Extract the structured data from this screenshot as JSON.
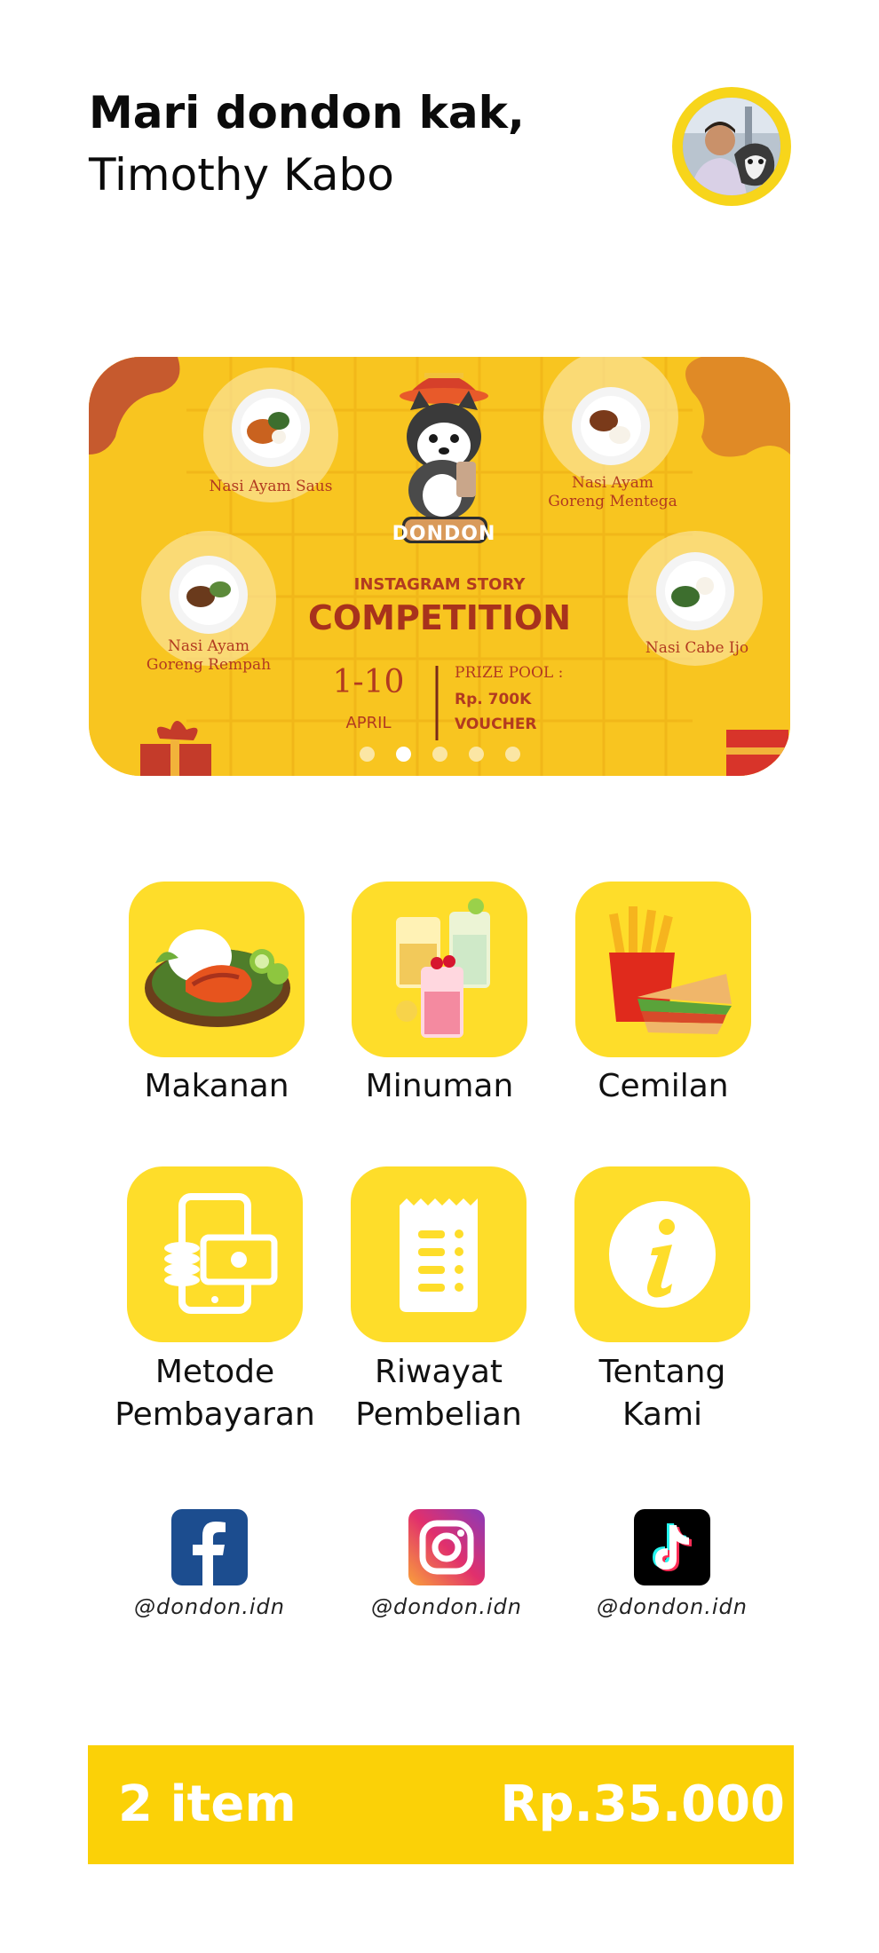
{
  "header": {
    "greeting": "Mari dondon kak,",
    "user_name": "Timothy Kabo",
    "avatar_icon": "user-avatar-photo"
  },
  "banner": {
    "logo_text": "DONDON",
    "items": [
      "Nasi Ayam Saus",
      "Nasi Ayam Goreng Mentega",
      "Nasi Ayam Goreng Rempah",
      "Nasi Cabe Ijo"
    ],
    "subtitle": "INSTAGRAM STORY",
    "title": "COMPETITION",
    "date": "1-10",
    "month": "APRIL",
    "prize_label": "PRIZE POOL :",
    "prize_amount": "Rp. 700K",
    "prize_type": "VOUCHER",
    "active_slide": 2,
    "slide_count": 5
  },
  "menu": {
    "categories": [
      {
        "label": "Makanan",
        "icon": "food-plate-icon"
      },
      {
        "label": "Minuman",
        "icon": "drinks-icon"
      },
      {
        "label": "Cemilan",
        "icon": "snack-icon"
      }
    ],
    "services": [
      {
        "line1": "Metode",
        "line2": "Pembayaran",
        "icon": "payment-method-icon"
      },
      {
        "line1": "Riwayat",
        "line2": "Pembelian",
        "icon": "receipt-icon"
      },
      {
        "line1": "Tentang",
        "line2": "Kami",
        "icon": "info-icon"
      }
    ]
  },
  "socials": [
    {
      "platform": "facebook",
      "handle": "@dondon.idn",
      "color": "#1c4d8f"
    },
    {
      "platform": "instagram",
      "handle": "@dondon.idn",
      "color": "#d62976"
    },
    {
      "platform": "tiktok",
      "handle": "@dondon.idn",
      "color": "#000000"
    }
  ],
  "cart": {
    "count_label": "2 item",
    "total_label": "Rp.35.000"
  },
  "colors": {
    "accent": "#fedd2a",
    "cart_bar": "#fbd107",
    "banner_bg": "#f8c520"
  }
}
